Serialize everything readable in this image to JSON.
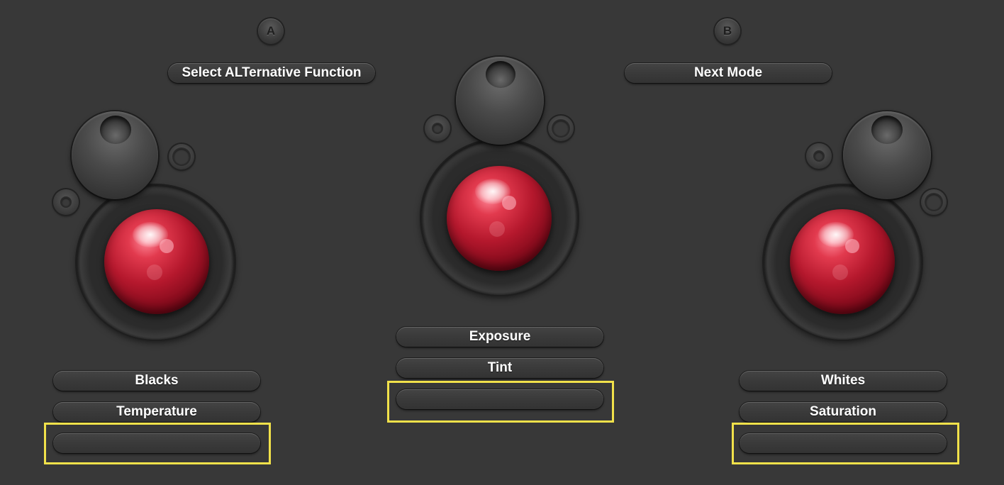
{
  "top_buttons": {
    "a_label": "A",
    "b_label": "B",
    "alt_function_label": "Select ALTernative Function",
    "next_mode_label": "Next Mode"
  },
  "left_panel": {
    "button1_label": "Blacks",
    "button2_label": "Temperature",
    "button3_label": ""
  },
  "center_panel": {
    "button1_label": "Exposure",
    "button2_label": "Tint",
    "button3_label": ""
  },
  "right_panel": {
    "button1_label": "Whites",
    "button2_label": "Saturation",
    "button3_label": ""
  },
  "colors": {
    "background": "#383838",
    "highlight": "#f1e14a",
    "trackball": "#b5182d"
  }
}
